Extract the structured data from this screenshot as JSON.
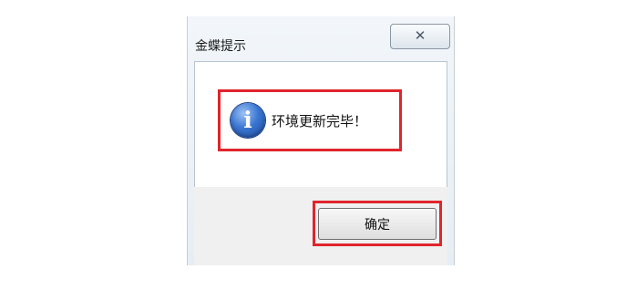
{
  "dialog": {
    "title": "金蝶提示",
    "close_glyph": "✕",
    "message": "环境更新完毕！",
    "icon": "info-icon",
    "ok_label": "确定"
  },
  "colors": {
    "highlight": "#e0252c",
    "icon_blue": "#3a76d2"
  }
}
